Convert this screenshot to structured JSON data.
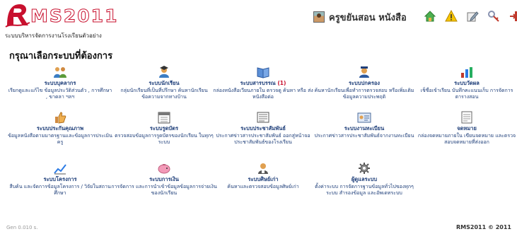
{
  "brand": {
    "logo_text": "MS2011",
    "school_name": "ระบบบริหารจัดการงานโรงเรียนตัวอย่าง"
  },
  "user": {
    "name": "ครูขยันสอน หนังสือ"
  },
  "toolbar": {
    "icons": [
      "home-icon",
      "warning-icon",
      "edit-icon",
      "key-icon",
      "logout-icon"
    ]
  },
  "main": {
    "title": "กรุณาเลือกระบบที่ต้องการ"
  },
  "modules": [
    {
      "title": "ระบบบุคลากร",
      "badge": "",
      "desc": "เรียกดูและแก้ไข ข้อมูลประวัติส่วนตัว , การศึกษา , ขาดลา ฯลฯ"
    },
    {
      "title": "ระบบนักเรียน",
      "badge": "",
      "desc": "กลุ่มนักเรียนที่เป็นที่ปรึกษา ค้นหานักเรียน ข้อความจากทางบ้าน"
    },
    {
      "title": "ระบบสารบรรณ",
      "badge": "(1)",
      "desc": "กล่องหนังสือเวียนภายใน ตรวจดู ค้นหา หรือ ส่งหนังสือต่อ"
    },
    {
      "title": "ระบบปกครอง",
      "badge": "",
      "desc": "ค้นหานักเรียนเพื่อทำการตรวจสอบ หรือเพิ่มเติมข้อมูลความประพฤติ"
    },
    {
      "title": "ระบบวัดผล",
      "badge": "",
      "desc": "เช็ชื่อเข้าเรียน บันทึกคะแนนเก็บ การจัดการตารางสอน"
    },
    {
      "title": "ระบบประกันคุณภาพ",
      "badge": "",
      "desc": "ข้อมูลหนังสือตามมาตรฐานและข้อมูลการประเมินครู"
    },
    {
      "title": "ระบบรูดบัตร",
      "badge": "",
      "desc": "ตรวจสอบข้อมูลการรูดบัตรของนักเรียน ในทุกๆ ระบบ"
    },
    {
      "title": "ระบบประชาสัมพันธ์",
      "badge": "",
      "desc": "ประกาศข่าวสารประชาสัมพันธ์ ออกสู่หน้าจอประชาสัมพันธ์ของโรงเรียน"
    },
    {
      "title": "ระบบงานทะเบียน",
      "badge": "",
      "desc": "ประกาศข่าวสารประชาสัมพันธ์จากงานทะเบียน"
    },
    {
      "title": "จดหมาย",
      "badge": "",
      "desc": "กล่องจดหมายภายใน เขียนจดหมาย และตรวจสอบจดหมายที่ส่งออก"
    },
    {
      "title": "ระบบโครงการ",
      "badge": "",
      "desc": "สืบค้น และจัดการข้อมูลโครงการ / วิจัยในสถานศึกษา"
    },
    {
      "title": "ระบบการเงิน",
      "badge": "",
      "desc": "การจัดการ และการนำเข้าข้อมูลข้อมูลการจ่ายเงินของนักเรียน"
    },
    {
      "title": "ระบบศิษย์เก่า",
      "badge": "",
      "desc": "ค้นหาและตรวจสอบข้อมูลศิษย์เก่า"
    },
    {
      "title": "ผู้ดูแลระบบ",
      "badge": "",
      "desc": "ตั้งค่าระบบ การจัดการฐานข้อมูลทั่วไปของทุกๆระบบ สำรองข้อมูล และอัพเดทระบบ"
    }
  ],
  "footer": {
    "gen_time": "Gen 0.010 s.",
    "copyright": "RMS2011 © 2011"
  }
}
